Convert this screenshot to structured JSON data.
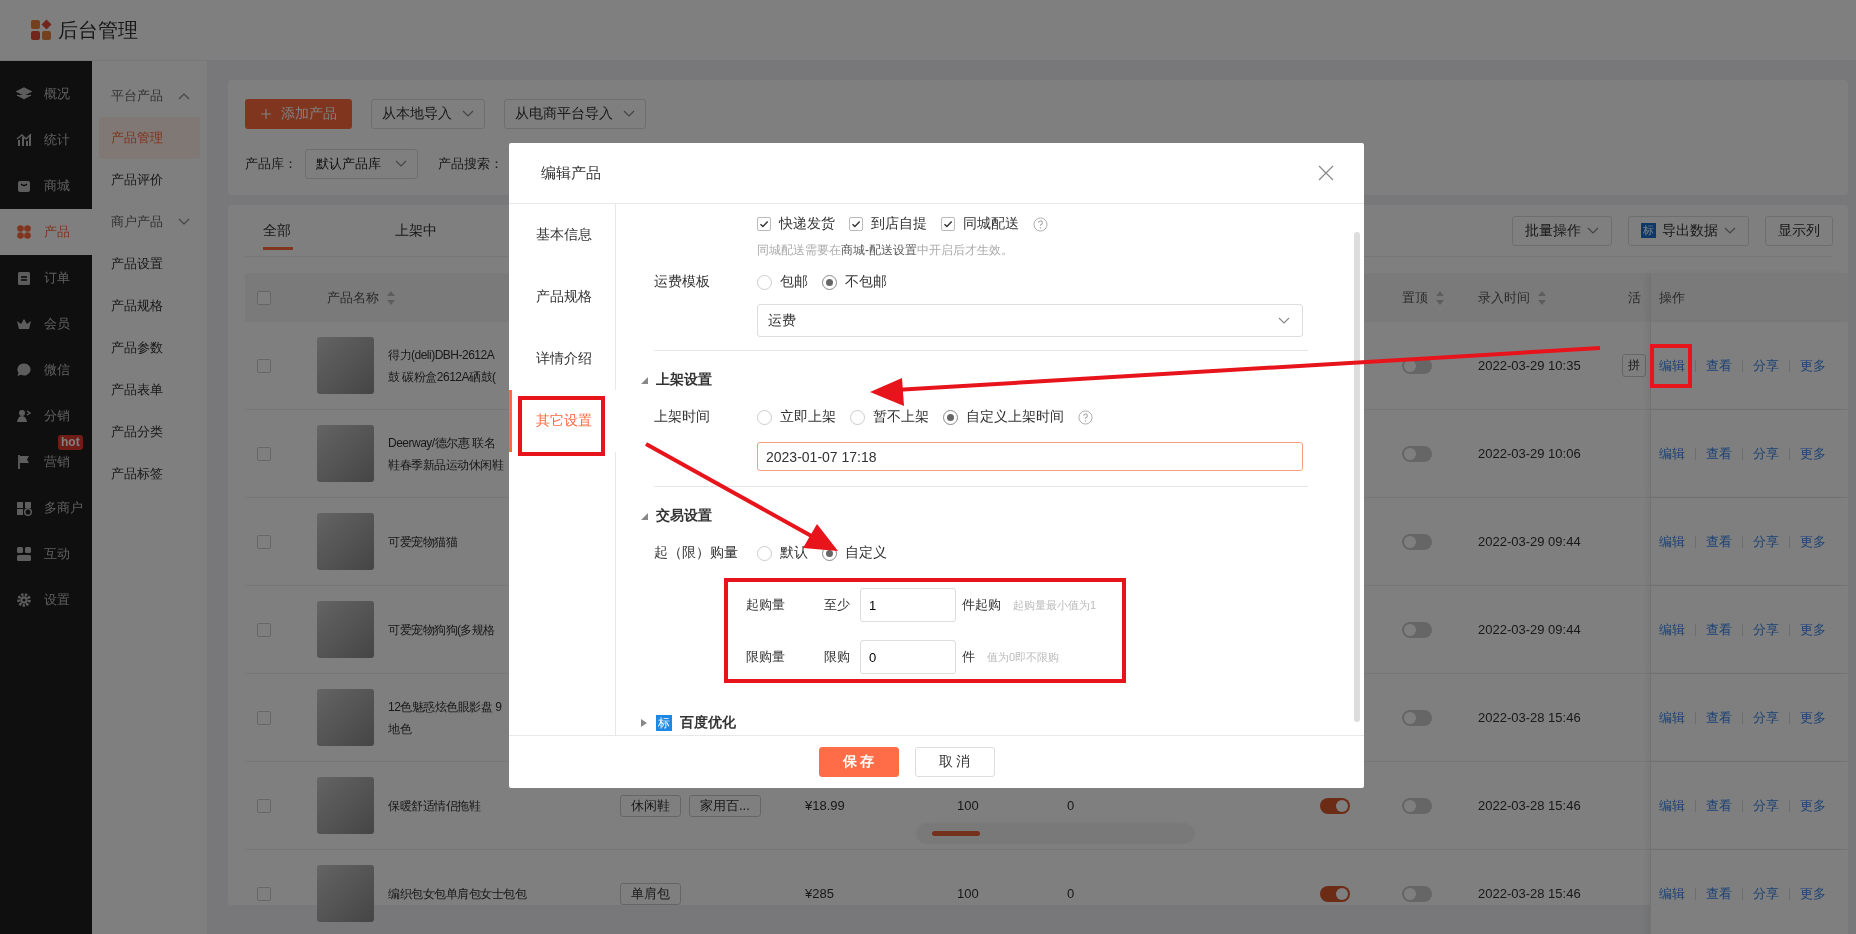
{
  "app": {
    "title": "后台管理"
  },
  "nav": [
    {
      "label": "概况",
      "selected": false
    },
    {
      "label": "统计",
      "selected": false
    },
    {
      "label": "商城",
      "selected": false
    },
    {
      "label": "产品",
      "selected": true
    },
    {
      "label": "订单",
      "selected": false
    },
    {
      "label": "会员",
      "selected": false
    },
    {
      "label": "微信",
      "selected": false
    },
    {
      "label": "分销",
      "selected": false
    },
    {
      "label": "营销",
      "selected": false,
      "badge": "hot"
    },
    {
      "label": "多商户",
      "selected": false
    },
    {
      "label": "互动",
      "selected": false
    },
    {
      "label": "设置",
      "selected": false
    }
  ],
  "subnav": [
    {
      "kind": "group",
      "label": "平台产品",
      "expanded": true
    },
    {
      "kind": "item",
      "label": "产品管理",
      "selected": true
    },
    {
      "kind": "item",
      "label": "产品评价",
      "selected": false
    },
    {
      "kind": "group",
      "label": "商户产品",
      "expanded": false
    },
    {
      "kind": "item",
      "label": "产品设置",
      "selected": false
    },
    {
      "kind": "item",
      "label": "产品规格",
      "selected": false
    },
    {
      "kind": "item",
      "label": "产品参数",
      "selected": false
    },
    {
      "kind": "item",
      "label": "产品表单",
      "selected": false
    },
    {
      "kind": "item",
      "label": "产品分类",
      "selected": false
    },
    {
      "kind": "item",
      "label": "产品标签",
      "selected": false
    }
  ],
  "toolbar": {
    "add_button": "添加产品",
    "import_buttons": [
      "从本地导入",
      "从电商平台导入"
    ],
    "filters": [
      {
        "label": "产品库：",
        "value": "默认产品库"
      },
      {
        "label": "产品搜索："
      }
    ]
  },
  "list": {
    "tabs": [
      {
        "label": "全部",
        "selected": true
      },
      {
        "label": "上架中",
        "selected": false
      }
    ],
    "actions": [
      {
        "kind": "dropdown",
        "label": "批量操作"
      },
      {
        "kind": "export",
        "label": "导出数据",
        "badge": "标"
      },
      {
        "kind": "plain",
        "label": "显示列"
      }
    ],
    "table": {
      "all_checked": false,
      "columns": [
        {
          "kind": "name",
          "label": "产品名称",
          "sortable": true
        },
        {
          "kind": "pin",
          "label": "置顶",
          "sortable": true
        },
        {
          "kind": "created",
          "label": "录入时间",
          "sortable": true
        },
        {
          "kind": "activity",
          "label": "活",
          "sortable": false
        },
        {
          "kind": "operations",
          "label": "操作",
          "sortable": false
        }
      ],
      "rows": [
        {
          "checked": false,
          "name": [
            "得力(deli)DBH-2612A",
            "鼓 碳粉盒2612A硒鼓("
          ],
          "pinned": false,
          "created": "2022-03-29 10:35",
          "activity": "拼",
          "actions": [
            "编辑",
            "查看",
            "分享",
            "更多"
          ]
        },
        {
          "checked": false,
          "name": [
            "Deerway/德尔惠 联名",
            "鞋春季新品运动休闲鞋"
          ],
          "pinned": false,
          "created": "2022-03-29 10:06",
          "actions": [
            "编辑",
            "查看",
            "分享",
            "更多"
          ]
        },
        {
          "checked": false,
          "name": [
            "可爱宠物猫猫"
          ],
          "pinned": false,
          "created": "2022-03-29 09:44",
          "actions": [
            "编辑",
            "查看",
            "分享",
            "更多"
          ]
        },
        {
          "checked": false,
          "name": [
            "可爱宠物狗狗(多规格"
          ],
          "pinned": false,
          "created": "2022-03-29 09:44",
          "actions": [
            "编辑",
            "查看",
            "分享",
            "更多"
          ]
        },
        {
          "checked": false,
          "name": [
            "12色魅惑炫色眼影盘 9",
            "地色"
          ],
          "pinned": false,
          "created": "2022-03-28 15:46",
          "actions": [
            "编辑",
            "查看",
            "分享",
            "更多"
          ]
        },
        {
          "checked": false,
          "name": [
            "保暖舒适情侣拖鞋"
          ],
          "tags": [
            "休闲鞋",
            "家用百..."
          ],
          "price": "¥18.99",
          "stock": "100",
          "sales": "0",
          "on_sale": true,
          "pinned": false,
          "created": "2022-03-28 15:46",
          "actions": [
            "编辑",
            "查看",
            "分享",
            "更多"
          ]
        },
        {
          "checked": false,
          "name": [
            "编织包女包单肩包女士包包"
          ],
          "tags": [
            "单肩包"
          ],
          "price": "¥285",
          "stock": "100",
          "sales": "0",
          "on_sale": true,
          "pinned": false,
          "created": "2022-03-28 15:46",
          "actions": [
            "编辑",
            "查看",
            "分享",
            "更多"
          ]
        }
      ]
    }
  },
  "dialog": {
    "title": "编辑产品",
    "tabs": [
      {
        "label": "基本信息",
        "selected": false
      },
      {
        "label": "产品规格",
        "selected": false
      },
      {
        "label": "详情介绍",
        "selected": false
      },
      {
        "label": "其它设置",
        "selected": true
      }
    ],
    "delivery": {
      "options": [
        {
          "label": "快递发货",
          "checked": true
        },
        {
          "label": "到店自提",
          "checked": true
        },
        {
          "label": "同城配送",
          "checked": true
        }
      ],
      "hint": "同城配送需要在**商城-配送设置**中开启后才生效。"
    },
    "shipping": {
      "label": "运费模板",
      "options": [
        {
          "label": "包邮",
          "selected": false
        },
        {
          "label": "不包邮",
          "selected": true
        }
      ],
      "template": "运费"
    },
    "listing": {
      "title": "上架设置",
      "expanded": true,
      "label": "上架时间",
      "options": [
        {
          "label": "立即上架",
          "selected": false
        },
        {
          "label": "暂不上架",
          "selected": false
        },
        {
          "label": "自定义上架时间",
          "selected": true
        }
      ],
      "value": "2023-01-07 17:18"
    },
    "trade": {
      "title": "交易设置",
      "expanded": true,
      "label": "起（限）购量",
      "options": [
        {
          "label": "默认",
          "selected": false
        },
        {
          "label": "自定义",
          "selected": true
        }
      ],
      "limits": [
        {
          "label": "起购量",
          "prefix": "至少",
          "value": "1",
          "suffix": "件起购",
          "hint": "起购量最小值为1"
        },
        {
          "label": "限购量",
          "prefix": "限购",
          "value": "0",
          "suffix": "件",
          "hint": "值为0即不限购"
        }
      ]
    },
    "seo": {
      "title": "百度优化",
      "badge": "标",
      "expanded": false
    },
    "buttons": [
      {
        "kind": "primary",
        "label": "保 存"
      },
      {
        "kind": "default",
        "label": "取 消"
      }
    ]
  }
}
